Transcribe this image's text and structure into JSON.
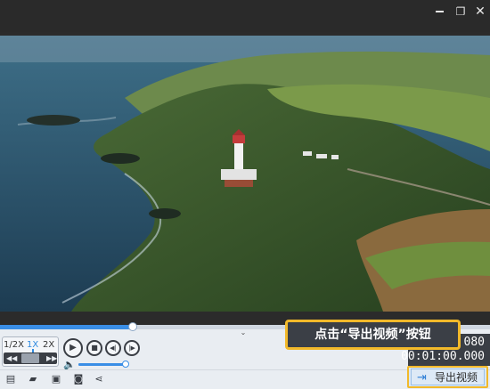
{
  "window": {
    "minimize_icon": "minimize-icon",
    "restore_icon": "restore-icon",
    "close_icon": "close-icon"
  },
  "player": {
    "progress_fraction": 0.27,
    "volume_fraction": 0.95,
    "speeds": [
      "1/2X",
      "1X",
      "2X"
    ],
    "active_speed": "1X",
    "time_total_partial": "080",
    "time_current": "00:01:00.000"
  },
  "tooltip": {
    "text": "点击“导出视频”按钮"
  },
  "toolbar": {
    "export_label": "导出视频",
    "icons": [
      "subtitle-icon",
      "folder-icon",
      "save-icon",
      "font-icon",
      "share-icon"
    ]
  },
  "colors": {
    "accent": "#3a8ee6",
    "highlight": "#f2b92a",
    "dark": "#3a3e45"
  }
}
